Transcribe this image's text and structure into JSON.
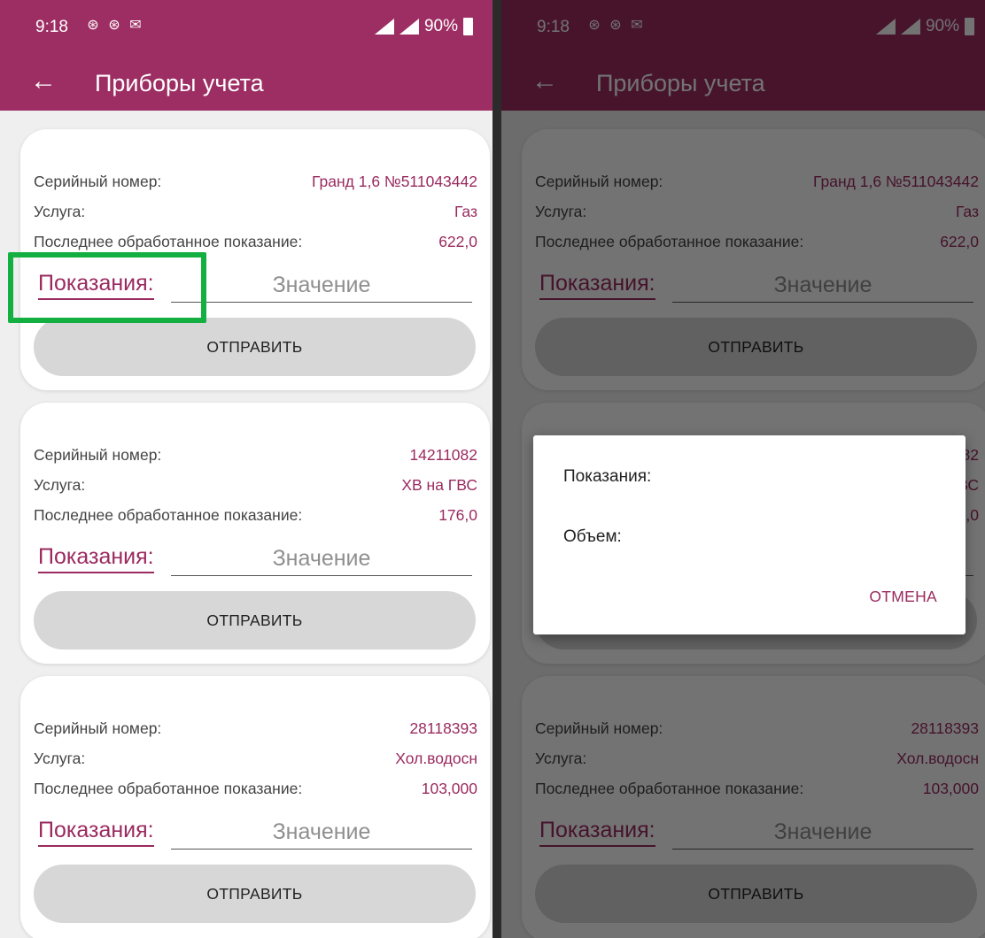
{
  "status_bar": {
    "time": "9:18",
    "battery": "90%"
  },
  "app_bar": {
    "back_icon": "arrow-left-icon",
    "title": "Приборы учета"
  },
  "meters": [
    {
      "serial_label": "Серийный номер:",
      "serial_value": "Гранд 1,6 №511043442",
      "service_label": "Услуга:",
      "service_value": "Газ",
      "last_label": "Последнее обработанное показание:",
      "last_value": "622,0",
      "readings_label": "Показания:",
      "input_placeholder": "Значение",
      "submit_label": "ОТПРАВИТЬ"
    },
    {
      "serial_label": "Серийный номер:",
      "serial_value": "14211082",
      "service_label": "Услуга:",
      "service_value": "ХВ на ГВС",
      "last_label": "Последнее обработанное показание:",
      "last_value": "176,0",
      "readings_label": "Показания:",
      "input_placeholder": "Значение",
      "submit_label": "ОТПРАВИТЬ"
    },
    {
      "serial_label": "Серийный номер:",
      "serial_value": "28118393",
      "service_label": "Услуга:",
      "service_value": "Хол.водосн",
      "last_label": "Последнее обработанное показание:",
      "last_value": "103,000",
      "readings_label": "Показания:",
      "input_placeholder": "Значение",
      "submit_label": "ОТПРАВИТЬ"
    }
  ],
  "dialog": {
    "readings_label": "Показания:",
    "volume_label": "Объем:",
    "cancel_label": "ОТМЕНА"
  },
  "colors": {
    "primary": "#9d2e63",
    "accent_text": "#9a2a5f",
    "highlight": "#13b041",
    "button_bg": "#d7d7d7"
  }
}
